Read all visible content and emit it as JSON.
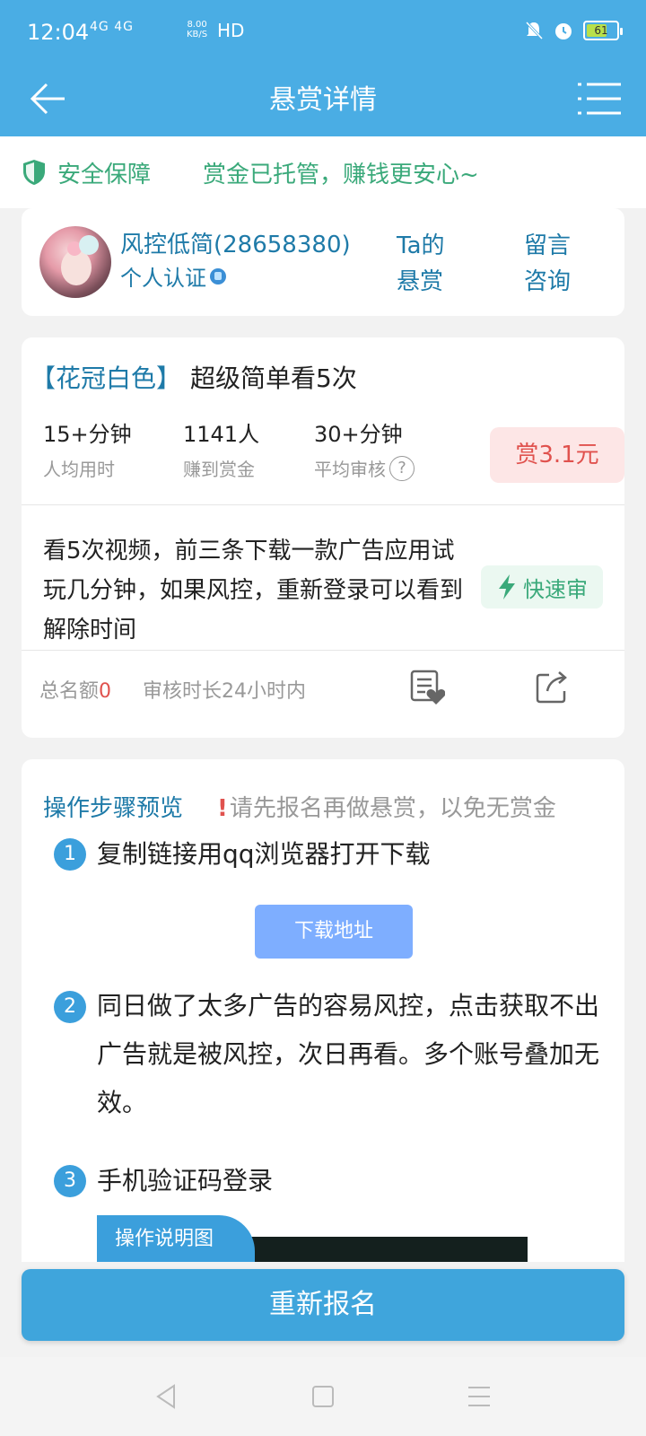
{
  "status_bar": {
    "time": "12:04",
    "network": "4G 4G",
    "speed": "8.00\nKB/S",
    "hd": "HD",
    "battery": "61"
  },
  "app_bar": {
    "title": "悬赏详情"
  },
  "safety": {
    "label": "安全保障",
    "slogan": "赏金已托管，赚钱更安心~"
  },
  "user": {
    "name": "风控低简(28658380)",
    "cert": "个人认证",
    "link_rewards": "Ta的\n悬赏",
    "link_message": "留言\n咨询"
  },
  "task": {
    "tag": "【花冠白色】",
    "title": "超级简单看5次",
    "stats": [
      {
        "value": "15+分钟",
        "label": "人均用时"
      },
      {
        "value": "1141人",
        "label": "赚到赏金"
      },
      {
        "value": "30+分钟",
        "label": "平均审核"
      }
    ],
    "reward": "赏3.1元",
    "description": "看5次视频，前三条下载一款广告应用试玩几分钟，如果风控，重新登录可以看到解除时间",
    "fast_review": "快速审",
    "quota_label": "总名额",
    "quota_value": "0",
    "review_time": "审核时长24小时内"
  },
  "steps": {
    "heading": "操作步骤预览",
    "warning_mark": "!",
    "warning": "请先报名再做悬赏，以免无赏金",
    "items": [
      {
        "num": "1",
        "text": "复制链接用qq浏览器打开下载"
      },
      {
        "num": "2",
        "text": "同日做了太多广告的容易风控，点击获取不出广告就是被风控，次日再看。多个账号叠加无效。"
      },
      {
        "num": "3",
        "text": "手机验证码登录"
      }
    ],
    "download_button": "下载地址",
    "image_tab": "操作说明图"
  },
  "cta": {
    "label": "重新报名"
  },
  "colors": {
    "header_blue": "#4aade4",
    "link_blue": "#1e7aa8",
    "safety_green": "#3aa97a",
    "reward_red": "#e0524e",
    "reward_bg": "#fde6e6",
    "button_blue": "#3fa5dc",
    "download_button": "#7eaeff"
  },
  "icons": [
    "back-arrow-icon",
    "menu-icon",
    "shield-icon",
    "help-icon",
    "lightning-icon",
    "document-heart-icon",
    "share-icon",
    "nav-back-icon",
    "nav-home-icon",
    "nav-menu-icon"
  ]
}
